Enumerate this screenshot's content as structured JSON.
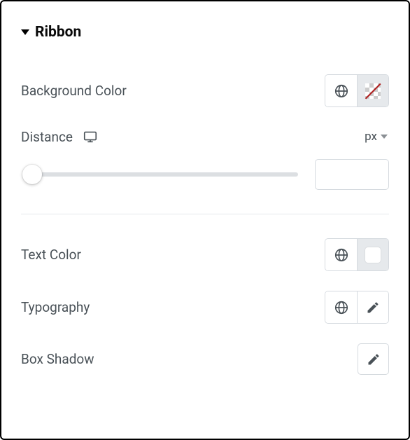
{
  "section": {
    "title": "Ribbon"
  },
  "controls": {
    "background_color": {
      "label": "Background Color"
    },
    "distance": {
      "label": "Distance",
      "unit": "px",
      "value": ""
    },
    "text_color": {
      "label": "Text Color"
    },
    "typography": {
      "label": "Typography"
    },
    "box_shadow": {
      "label": "Box Shadow"
    }
  }
}
